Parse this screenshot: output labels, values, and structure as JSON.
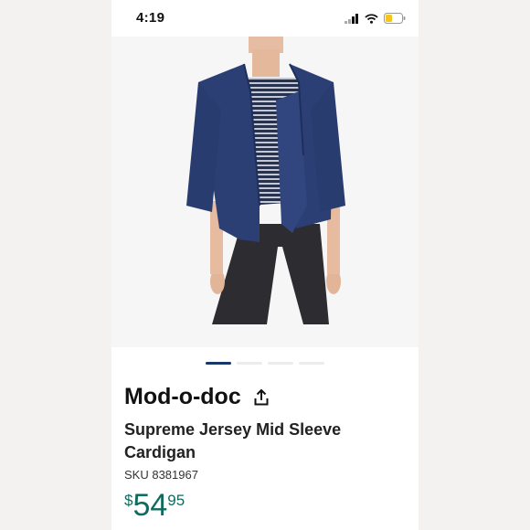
{
  "status_bar": {
    "time": "4:19",
    "icons": [
      "signal-icon",
      "wifi-icon",
      "battery-icon"
    ],
    "battery_color": "#f5c518"
  },
  "product": {
    "image_alt": "navy cardigan worn over striped top",
    "carousel": {
      "total": 4,
      "active": 1
    },
    "brand": "Mod-o-doc",
    "share_icon": "share-icon",
    "name": "Supreme Jersey Mid Sleeve Cardigan",
    "sku": "SKU 8381967",
    "price": {
      "currency": "$",
      "dollars": "54",
      "cents": "95"
    },
    "colors": {
      "price": "#0f6b5d",
      "active_dot": "#16396a",
      "cardigan": "#2b3f74"
    }
  }
}
